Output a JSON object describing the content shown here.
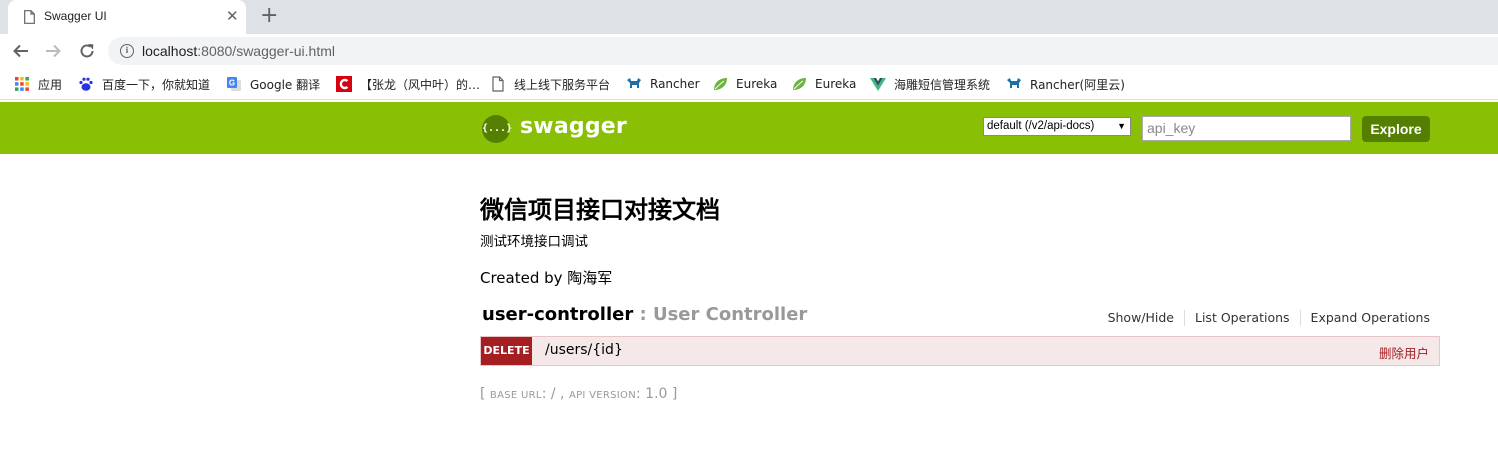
{
  "browser": {
    "tab_title": "Swagger UI",
    "tab_close": "✕",
    "new_tab": "+",
    "url_host": "localhost",
    "url_rest": ":8080/swagger-ui.html",
    "info_icon_char": "i",
    "bookmarks": [
      {
        "label": "应用",
        "icon": "apps-grid-icon"
      },
      {
        "label": "百度一下，你就知道",
        "icon": "baidu-paw-icon"
      },
      {
        "label": "Google 翻译",
        "icon": "google-translate-icon"
      },
      {
        "label": "【张龙（风中叶）的…",
        "icon": "c-logo-icon"
      },
      {
        "label": "线上线下服务平台",
        "icon": "document-icon"
      },
      {
        "label": "Rancher",
        "icon": "rancher-icon"
      },
      {
        "label": "Eureka",
        "icon": "spring-leaf-icon"
      },
      {
        "label": "Eureka",
        "icon": "spring-leaf-icon"
      },
      {
        "label": "海雕短信管理系统",
        "icon": "vue-icon"
      },
      {
        "label": "Rancher(阿里云)",
        "icon": "rancher-icon"
      }
    ]
  },
  "swagger": {
    "logo_mark": "{...}",
    "logo_text": "swagger",
    "spec_select": "default (/v2/api-docs)",
    "api_key_placeholder": "api_key",
    "explore_label": "Explore",
    "brand_color": "#89bf04",
    "brand_dark": "#547f00"
  },
  "info": {
    "title": "微信项目接口对接文档",
    "description": "测试环境接口调试",
    "created_by": "Created by 陶海军"
  },
  "resource": {
    "name": "user-controller",
    "separator": " : ",
    "description": "User Controller",
    "show_hide": "Show/Hide",
    "list_operations": "List Operations",
    "expand_operations": "Expand Operations",
    "operation": {
      "method": "DELETE",
      "path": "/users/{id}",
      "summary": "删除用户",
      "method_color": "#a41e22"
    }
  },
  "footer": {
    "open": "[ ",
    "base_url_label": "BASE URL",
    "base_url_value": ": / , ",
    "api_version_label": "API VERSION",
    "api_version_value": ": 1.0 ]"
  }
}
